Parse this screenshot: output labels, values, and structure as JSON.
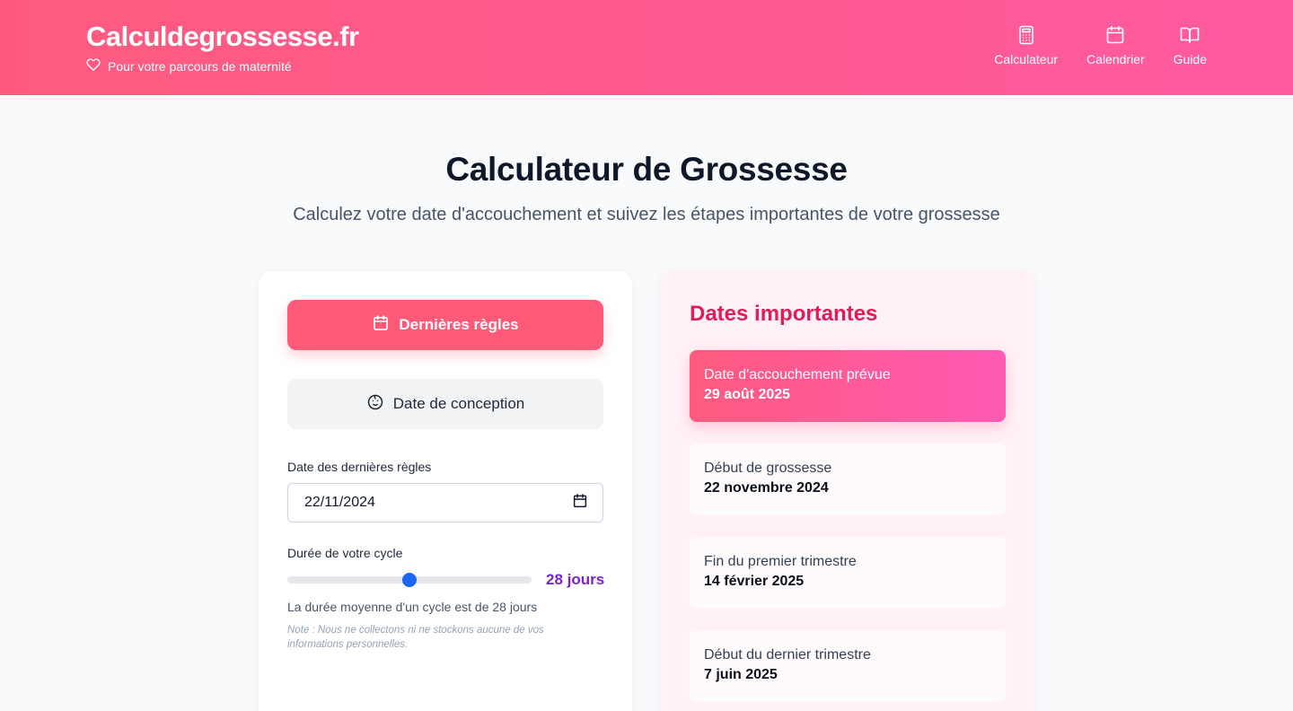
{
  "header": {
    "brand_title": "Calculdegrossesse.fr",
    "brand_subtitle": "Pour votre parcours de maternité",
    "nav": [
      {
        "label": "Calculateur",
        "icon": "calculator-icon"
      },
      {
        "label": "Calendrier",
        "icon": "calendar-icon"
      },
      {
        "label": "Guide",
        "icon": "book-icon"
      }
    ]
  },
  "hero": {
    "title": "Calculateur de Grossesse",
    "subtitle": "Calculez votre date d'accouchement et suivez les étapes importantes de votre grossesse"
  },
  "form": {
    "mode_buttons": [
      {
        "label": "Dernières règles",
        "icon": "calendar-icon",
        "active": true
      },
      {
        "label": "Date de conception",
        "icon": "baby-face-icon",
        "active": false
      }
    ],
    "date_label": "Date des dernières règles",
    "date_value": "22/11/2024",
    "cycle_label": "Durée de votre cycle",
    "cycle_value": 28,
    "cycle_fraction": 0.5,
    "cycle_value_text": "28 jours",
    "cycle_hint": "La durée moyenne d'un cycle est de 28 jours",
    "note": "Note : Nous ne collectons ni ne stockons aucune de vos informations personnelles."
  },
  "dates": {
    "title": "Dates importantes",
    "items": [
      {
        "label": "Date d'accouchement prévue",
        "value": "29 août 2025",
        "highlight": true
      },
      {
        "label": "Début de grossesse",
        "value": "22 novembre 2024",
        "highlight": false
      },
      {
        "label": "Fin du premier trimestre",
        "value": "14 février 2025",
        "highlight": false
      },
      {
        "label": "Début du dernier trimestre",
        "value": "7 juin 2025",
        "highlight": false
      }
    ]
  },
  "colors": {
    "brand_pink": "#ff5a7e",
    "accent_red": "#e11d59",
    "cycle_purple": "#7e22ce",
    "slider_blue": "#1a66f5"
  }
}
